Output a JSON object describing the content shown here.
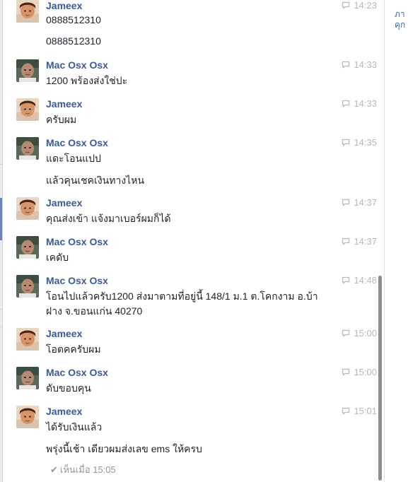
{
  "conversation": {
    "messages": [
      {
        "sender": "Jameex",
        "avatar": "jameex",
        "time": "14:23",
        "lines": [
          "0888512310",
          "0888512310"
        ]
      },
      {
        "sender": "Mac Osx Osx",
        "avatar": "mac",
        "time": "14:33",
        "lines": [
          "1200 พร้องส่งใช่ปะ"
        ]
      },
      {
        "sender": "Jameex",
        "avatar": "jameex",
        "time": "14:33",
        "lines": [
          "ครับผม"
        ]
      },
      {
        "sender": "Mac Osx Osx",
        "avatar": "mac",
        "time": "14:35",
        "lines": [
          "แดะโอนแปป",
          "แล้วคุนเชคเงินทางไหน"
        ]
      },
      {
        "sender": "Jameex",
        "avatar": "jameex",
        "time": "14:37",
        "lines": [
          "คุณส่งเข้า แจ้งมาเบอร์ผมก็ได้"
        ]
      },
      {
        "sender": "Mac Osx Osx",
        "avatar": "mac",
        "time": "14:37",
        "lines": [
          "เคดับ"
        ]
      },
      {
        "sender": "Mac Osx Osx",
        "avatar": "mac",
        "time": "14:48",
        "lines": [
          "โอนไปแล้วครับ1200  ส่งมาตามที่อยู่นี้  148/1 ม.1  ต.โคกงาม อ.บ้า",
          "ฝาง จ.ขอนแก่น  40270"
        ]
      },
      {
        "sender": "Jameex",
        "avatar": "jameex",
        "time": "15:00",
        "lines": [
          "โอตคครับผม"
        ]
      },
      {
        "sender": "Mac Osx Osx",
        "avatar": "mac",
        "time": "15:00",
        "lines": [
          "ดับขอบคุน"
        ]
      },
      {
        "sender": "Jameex",
        "avatar": "jameex",
        "time": "15:01",
        "lines": [
          "ได้รับเงินแล้ว",
          "พรุ่งนี้เช้า เดียวผมส่งเลข ems ให้ครบ"
        ]
      }
    ],
    "seen_text": "เห็นเมื่อ 15:05"
  },
  "right_panel": {
    "line1": "ภา",
    "line2": "คุก"
  },
  "colors": {
    "name": "#3b5998",
    "text": "#1d2129",
    "meta": "#b4b8c0",
    "scroll_thumb": "#8b8d90"
  },
  "icons": {
    "timestamp_icon": "speech-bubble-icon",
    "seen_icon": "check-icon"
  }
}
